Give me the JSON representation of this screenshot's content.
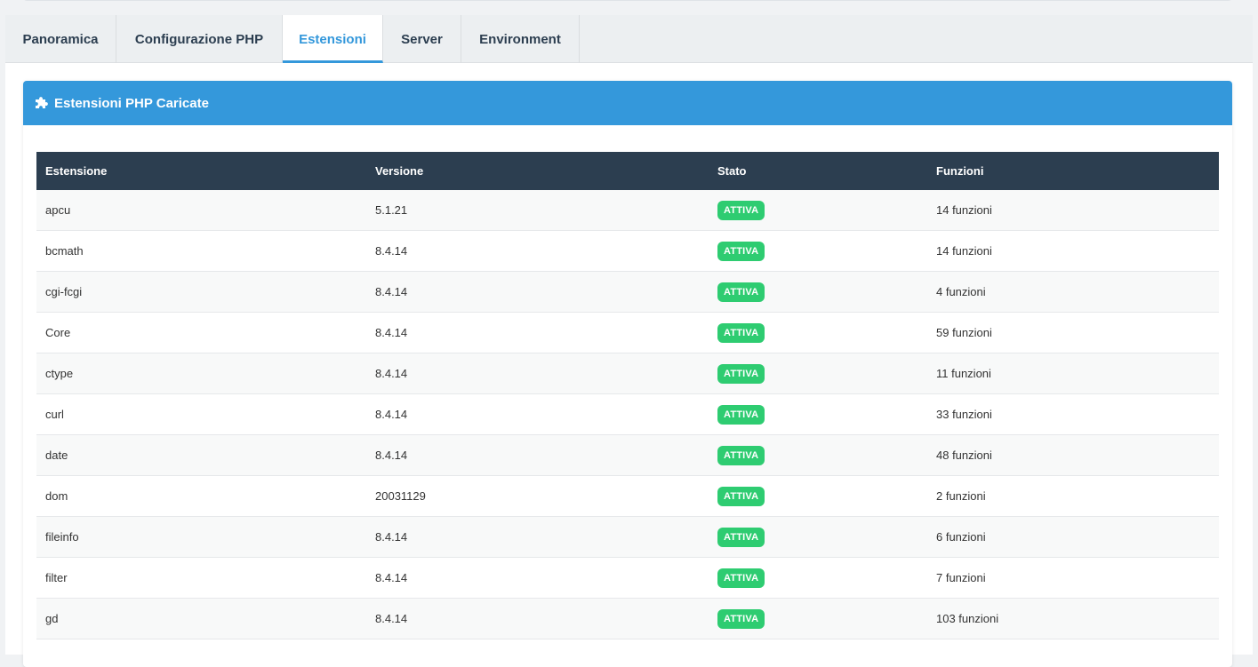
{
  "tabs": [
    {
      "label": "Panoramica",
      "active": false
    },
    {
      "label": "Configurazione PHP",
      "active": false
    },
    {
      "label": "Estensioni",
      "active": true
    },
    {
      "label": "Server",
      "active": false
    },
    {
      "label": "Environment",
      "active": false
    }
  ],
  "card": {
    "title": "Estensioni PHP Caricate",
    "icon": "puzzle-icon"
  },
  "table": {
    "headers": [
      "Estensione",
      "Versione",
      "Stato",
      "Funzioni"
    ],
    "rows": [
      {
        "name": "apcu",
        "version": "5.1.21",
        "status": "ATTIVA",
        "functions": "14 funzioni"
      },
      {
        "name": "bcmath",
        "version": "8.4.14",
        "status": "ATTIVA",
        "functions": "14 funzioni"
      },
      {
        "name": "cgi-fcgi",
        "version": "8.4.14",
        "status": "ATTIVA",
        "functions": "4 funzioni"
      },
      {
        "name": "Core",
        "version": "8.4.14",
        "status": "ATTIVA",
        "functions": "59 funzioni"
      },
      {
        "name": "ctype",
        "version": "8.4.14",
        "status": "ATTIVA",
        "functions": "11 funzioni"
      },
      {
        "name": "curl",
        "version": "8.4.14",
        "status": "ATTIVA",
        "functions": "33 funzioni"
      },
      {
        "name": "date",
        "version": "8.4.14",
        "status": "ATTIVA",
        "functions": "48 funzioni"
      },
      {
        "name": "dom",
        "version": "20031129",
        "status": "ATTIVA",
        "functions": "2 funzioni"
      },
      {
        "name": "fileinfo",
        "version": "8.4.14",
        "status": "ATTIVA",
        "functions": "6 funzioni"
      },
      {
        "name": "filter",
        "version": "8.4.14",
        "status": "ATTIVA",
        "functions": "7 funzioni"
      },
      {
        "name": "gd",
        "version": "8.4.14",
        "status": "ATTIVA",
        "functions": "103 funzioni"
      }
    ]
  },
  "colors": {
    "accent": "#3498db",
    "header_dark": "#2c3e50",
    "status_active": "#2ecc71"
  }
}
